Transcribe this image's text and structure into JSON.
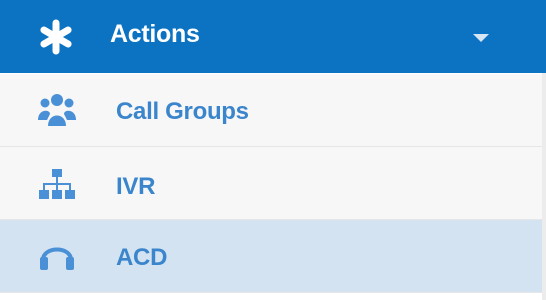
{
  "menu": {
    "header": {
      "label": "Actions",
      "icon": "asterisk-icon",
      "chevron": "chevron-down-icon",
      "background": "#0c73c2",
      "text_color": "#ffffff"
    },
    "items": [
      {
        "label": "Call Groups",
        "icon": "users-group-icon",
        "active": false
      },
      {
        "label": "IVR",
        "icon": "sitemap-icon",
        "active": false
      },
      {
        "label": "ACD",
        "icon": "headset-icon",
        "active": true
      }
    ],
    "colors": {
      "item_text": "#3a85cc",
      "item_icon": "#4a90d6",
      "item_bg": "#f7f7f7",
      "active_bg": "#d4e3f1"
    }
  }
}
